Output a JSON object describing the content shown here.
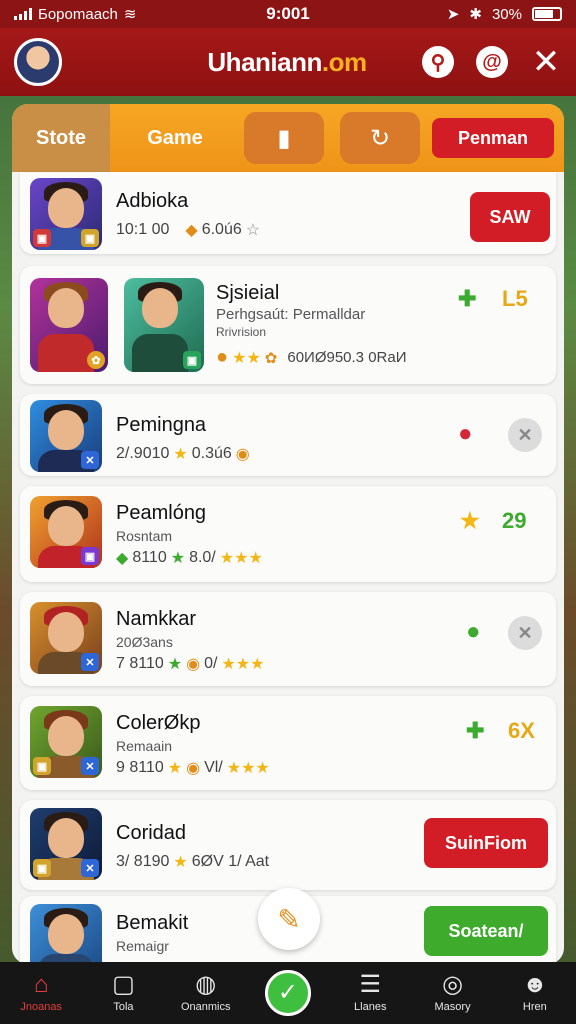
{
  "status_bar": {
    "carrier": "Бopomaach",
    "time": "9:001",
    "battery": "30%"
  },
  "app_bar": {
    "title_main": "Uhaniann",
    "title_accent": ".om"
  },
  "tabs": {
    "store": "Stote",
    "game": "Game",
    "pill": "Penman"
  },
  "rows": [
    {
      "title": "Adbioka",
      "meta": "10:1 00",
      "meta2": "6.0ú6",
      "button": "SAW"
    },
    {
      "title": "Sjsieial",
      "sub": "Perhgsaút: Permalldar",
      "sub2": "Rrivrision",
      "meta": "60ИØ950.3 0RaИ",
      "value": "L5"
    },
    {
      "title": "Pemingna",
      "meta": "2/.9010",
      "meta2": "0.3ú6"
    },
    {
      "title": "Peamlóng",
      "sub": "Rosntam",
      "meta": "8110",
      "meta2": "8.0/",
      "value": "29"
    },
    {
      "title": "Namkkar",
      "sub": "20Ø3ans",
      "meta": "7  8110",
      "meta2": "0/"
    },
    {
      "title": "ColerØkp",
      "sub": "Remaain",
      "meta": "9  8110",
      "meta2": "Vl/",
      "value": "6X"
    },
    {
      "title": "Coridad",
      "meta": "3/ 8190",
      "meta2": "6ØV 1/ Aat",
      "button": "SuinFiom"
    },
    {
      "title": "Bemakit",
      "sub": "Remaigr",
      "button": "Soatean/"
    }
  ],
  "bottom_nav": [
    "Jnoanas",
    "Tola",
    "Onanmics",
    "Llanes",
    "Masory",
    "Hren"
  ],
  "colors": {
    "brand_red": "#a51818",
    "accent_orange": "#f6a623",
    "button_red": "#d31d26",
    "button_green": "#3fab2c"
  }
}
